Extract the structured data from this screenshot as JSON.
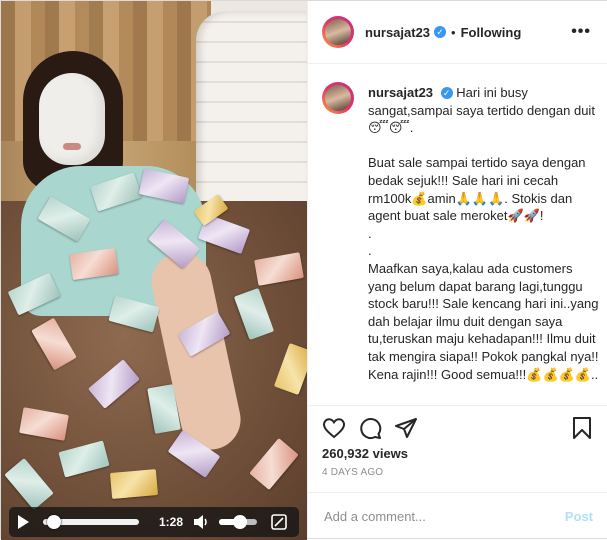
{
  "video": {
    "time": "1:28",
    "progress": 0.05,
    "volume": 0.6
  },
  "header": {
    "username": "nursajat23",
    "separator": "•",
    "follow_status": "Following",
    "more_label": "•••"
  },
  "caption": {
    "username": "nursajat23",
    "text": "Hari ini busy sangat,sampai saya tertido dengan duit😴😴.\n\nBuat sale sampai tertido saya dengan bedak sejuk!!! Sale hari ini cecah rm100k💰amin🙏🙏🙏. Stokis dan agent buat sale meroket🚀🚀!\n.\n.\nMaafkan saya,kalau ada customers yang belum dapat barang lagi,tunggu stock baru!!! Sale kencang hari ini..yang dah belajar ilmu duit dengan saya tu,teruskan maju kehadapan!!! Ilmu duit tak mengira siapa!! Pokok pangkal nya!! Kena rajin!!! Good semua!!!💰💰💰💰.."
  },
  "actions": {
    "likes": "260,932 views",
    "date": "4 DAYS AGO"
  },
  "comment": {
    "placeholder": "Add a comment...",
    "post_label": "Post"
  },
  "colors": {
    "verified": "#3897f0",
    "post_disabled": "#b2dffc",
    "meta_gray": "#8e8e8e"
  }
}
